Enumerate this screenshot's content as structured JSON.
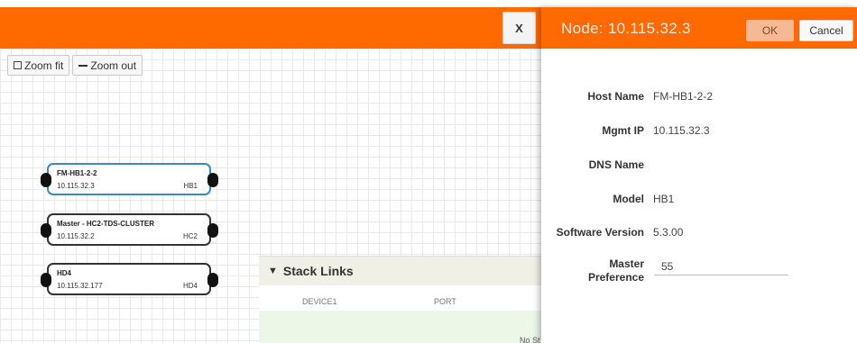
{
  "topbar": {
    "close_label": "X"
  },
  "zoom": {
    "fit_label": "Zoom fit",
    "out_label": "Zoom out"
  },
  "nodes": [
    {
      "name": "FM-HB1-2-2",
      "ip": "10.115.32.3",
      "model": "HB1",
      "selected": true
    },
    {
      "name": "Master - HC2-TDS-CLUSTER",
      "ip": "10.115.32.2",
      "model": "HC2",
      "selected": false
    },
    {
      "name": "HD4",
      "ip": "10.115.32.177",
      "model": "HD4",
      "selected": false
    }
  ],
  "stack_links": {
    "title": "Stack Links",
    "columns": [
      "DEVICE1",
      "PORT"
    ],
    "empty_message": "No St"
  },
  "panel": {
    "title": "Node: 10.115.32.3",
    "ok_label": "OK",
    "cancel_label": "Cancel",
    "fields": [
      {
        "label": "Host Name",
        "value": "FM-HB1-2-2"
      },
      {
        "label": "Mgmt IP",
        "value": "10.115.32.3"
      },
      {
        "label": "DNS Name",
        "value": ""
      },
      {
        "label": "Model",
        "value": "HB1"
      },
      {
        "label": "Software Version",
        "value": "5.3.00"
      }
    ],
    "master_preference": {
      "label_line1": "Master",
      "label_line2": "Preference",
      "value": "55"
    }
  },
  "colors": {
    "brand_orange": "#ff6a00",
    "selected_node_border": "#3a88c8"
  }
}
